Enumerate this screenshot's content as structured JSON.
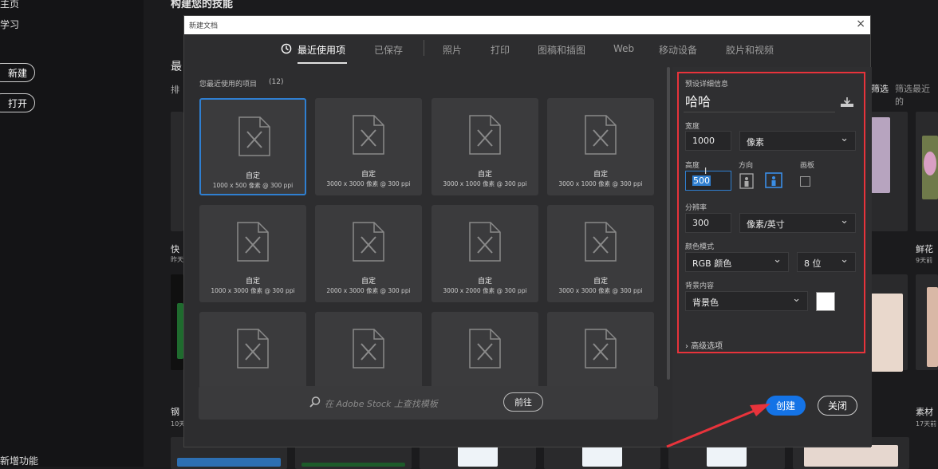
{
  "background": {
    "nav": {
      "home": "主页",
      "learn": "学习",
      "new_btn": "新建",
      "open_btn": "打开",
      "whats_new": "新增功能"
    },
    "header_partial": "构建您的技能",
    "recent_partial": "最",
    "sort_partial": "排",
    "filter_label": "筛选",
    "filter_placeholder": "筛选最近的",
    "items": [
      {
        "title": "快",
        "time": "昨天"
      },
      {
        "title": "钢",
        "time": "10天"
      },
      {
        "title": "鲜花",
        "time": "9天前"
      },
      {
        "title": "素材",
        "time": "17天前"
      }
    ]
  },
  "dialog": {
    "title": "新建文档",
    "close_glyph": "×",
    "tabs": [
      {
        "label": "最近使用项",
        "active": true
      },
      {
        "label": "已保存"
      },
      {
        "label": "照片"
      },
      {
        "label": "打印"
      },
      {
        "label": "图稿和插图"
      },
      {
        "label": "Web"
      },
      {
        "label": "移动设备"
      },
      {
        "label": "胶片和视频"
      }
    ],
    "recent_label": "您最近使用的项目",
    "recent_count": "(12)",
    "cards": [
      {
        "name": "自定",
        "spec": "1000 x 500 像素 @ 300 ppi",
        "selected": true
      },
      {
        "name": "自定",
        "spec": "3000 x 3000 像素 @ 300 ppi"
      },
      {
        "name": "自定",
        "spec": "3000 x 1000 像素 @ 300 ppi"
      },
      {
        "name": "自定",
        "spec": "3000 x 1000 像素 @ 300 ppi"
      },
      {
        "name": "自定",
        "spec": "1000 x 3000 像素 @ 300 ppi"
      },
      {
        "name": "自定",
        "spec": "2000 x 3000 像素 @ 300 ppi"
      },
      {
        "name": "自定",
        "spec": "3000 x 2000 像素 @ 300 ppi"
      },
      {
        "name": "自定",
        "spec": "3000 x 3000 像素 @ 300 ppi"
      },
      {
        "name": "",
        "spec": ""
      },
      {
        "name": "",
        "spec": ""
      },
      {
        "name": "",
        "spec": ""
      },
      {
        "name": "",
        "spec": ""
      }
    ],
    "stock_placeholder": "在 Adobe Stock 上查找模板",
    "stock_go": "前往",
    "details": {
      "section": "预设详细信息",
      "preset_name": "哈哈",
      "width_label": "宽度",
      "width_value": "1000",
      "width_unit": "像素",
      "height_label": "高度",
      "height_value": "500",
      "orientation_label": "方向",
      "artboard_label": "画板",
      "resolution_label": "分辨率",
      "resolution_value": "300",
      "resolution_unit": "像素/英寸",
      "color_mode_label": "颜色模式",
      "color_mode": "RGB 颜色",
      "bit_depth": "8 位",
      "bg_label": "背景内容",
      "bg_value": "背景色",
      "bg_color": "#ffffff",
      "advanced": "高级选项"
    },
    "create_btn": "创建",
    "close_btn": "关闭"
  },
  "annotation": {
    "highlight_color": "#e8333b"
  }
}
